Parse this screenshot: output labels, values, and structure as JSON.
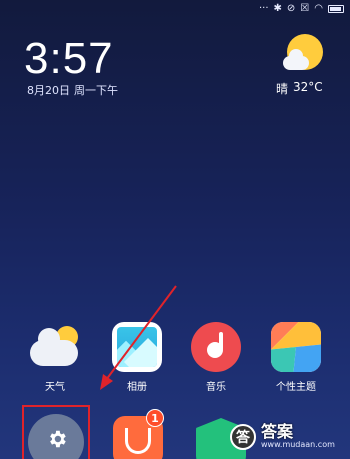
{
  "statusbar": {
    "icons": [
      "dots-icon",
      "bluetooth-icon",
      "silent-icon",
      "sim-icon",
      "wifi-icon",
      "battery-icon"
    ],
    "dots": "···",
    "bluetooth": "✱",
    "silent": "⊘",
    "sim": "☒",
    "wifi": "◠"
  },
  "clock": {
    "time": "3:57",
    "date": "8月20日",
    "weekday_period": "周一下午"
  },
  "weather": {
    "condition": "晴",
    "temperature": "32°C"
  },
  "apps": [
    {
      "label": "天气",
      "icon": "weather-icon"
    },
    {
      "label": "相册",
      "icon": "gallery-icon"
    },
    {
      "label": "音乐",
      "icon": "music-icon"
    },
    {
      "label": "个性主题",
      "icon": "themes-icon"
    }
  ],
  "bottom_row": {
    "settings_icon": "gear-icon",
    "store_badge": "1",
    "store_icon": "shopping-bag-icon",
    "security_icon": "shield-icon"
  },
  "annotations": {
    "highlight_color": "#e0232a",
    "arrow_color": "#e0232a"
  },
  "watermark": {
    "seal": "答",
    "title": "答案",
    "url": "www.mudaan.com"
  }
}
